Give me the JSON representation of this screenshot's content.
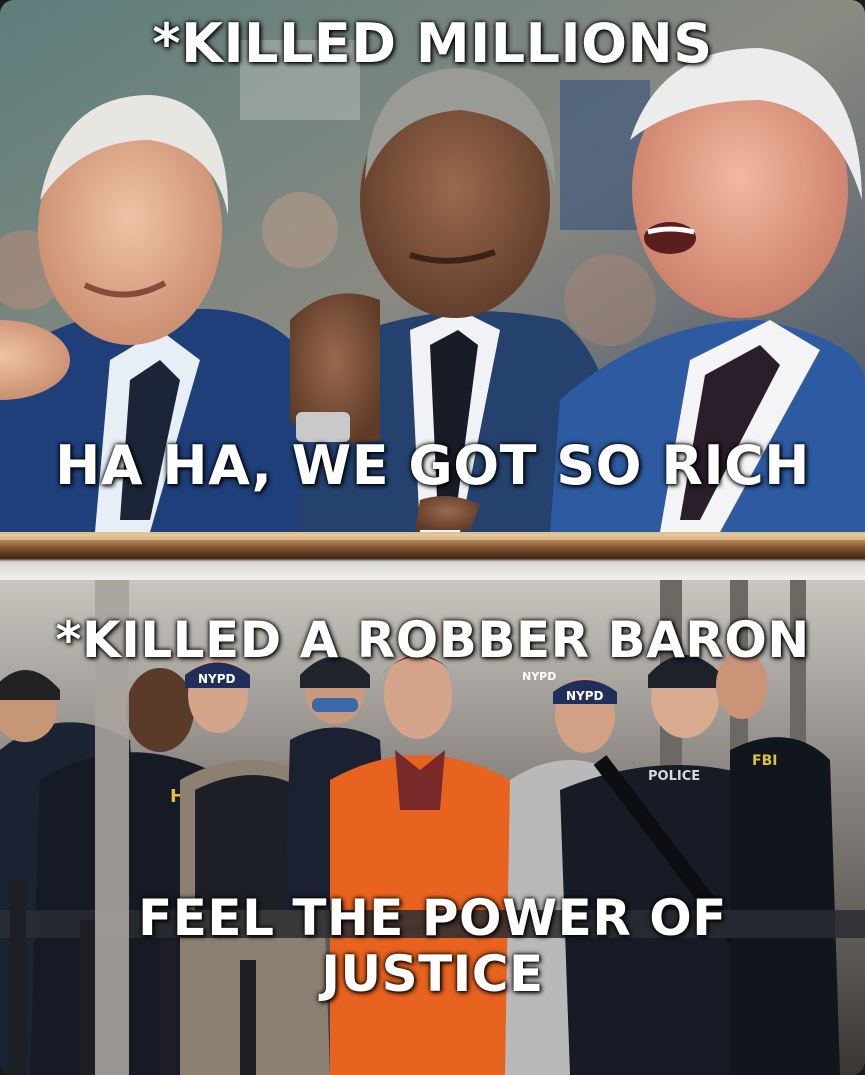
{
  "top_panel": {
    "caption_top": "*KILLED MILLIONS",
    "caption_bottom": "HA HA, WE GOT SO RICH"
  },
  "bottom_panel": {
    "caption_top": "*KILLED A ROBBER BARON",
    "caption_bottom_line1": "FEEL THE POWER OF",
    "caption_bottom_line2": "JUSTICE",
    "badges": [
      "NYPD",
      "NYPD",
      "NYPD",
      "POLICE",
      "HSI",
      "FBI"
    ]
  },
  "colors": {
    "jumpsuit": "#e8631f",
    "suit_blue": "#1f3f7a",
    "tactical_navy": "#1b2333",
    "caption_text": "#ffffff"
  }
}
